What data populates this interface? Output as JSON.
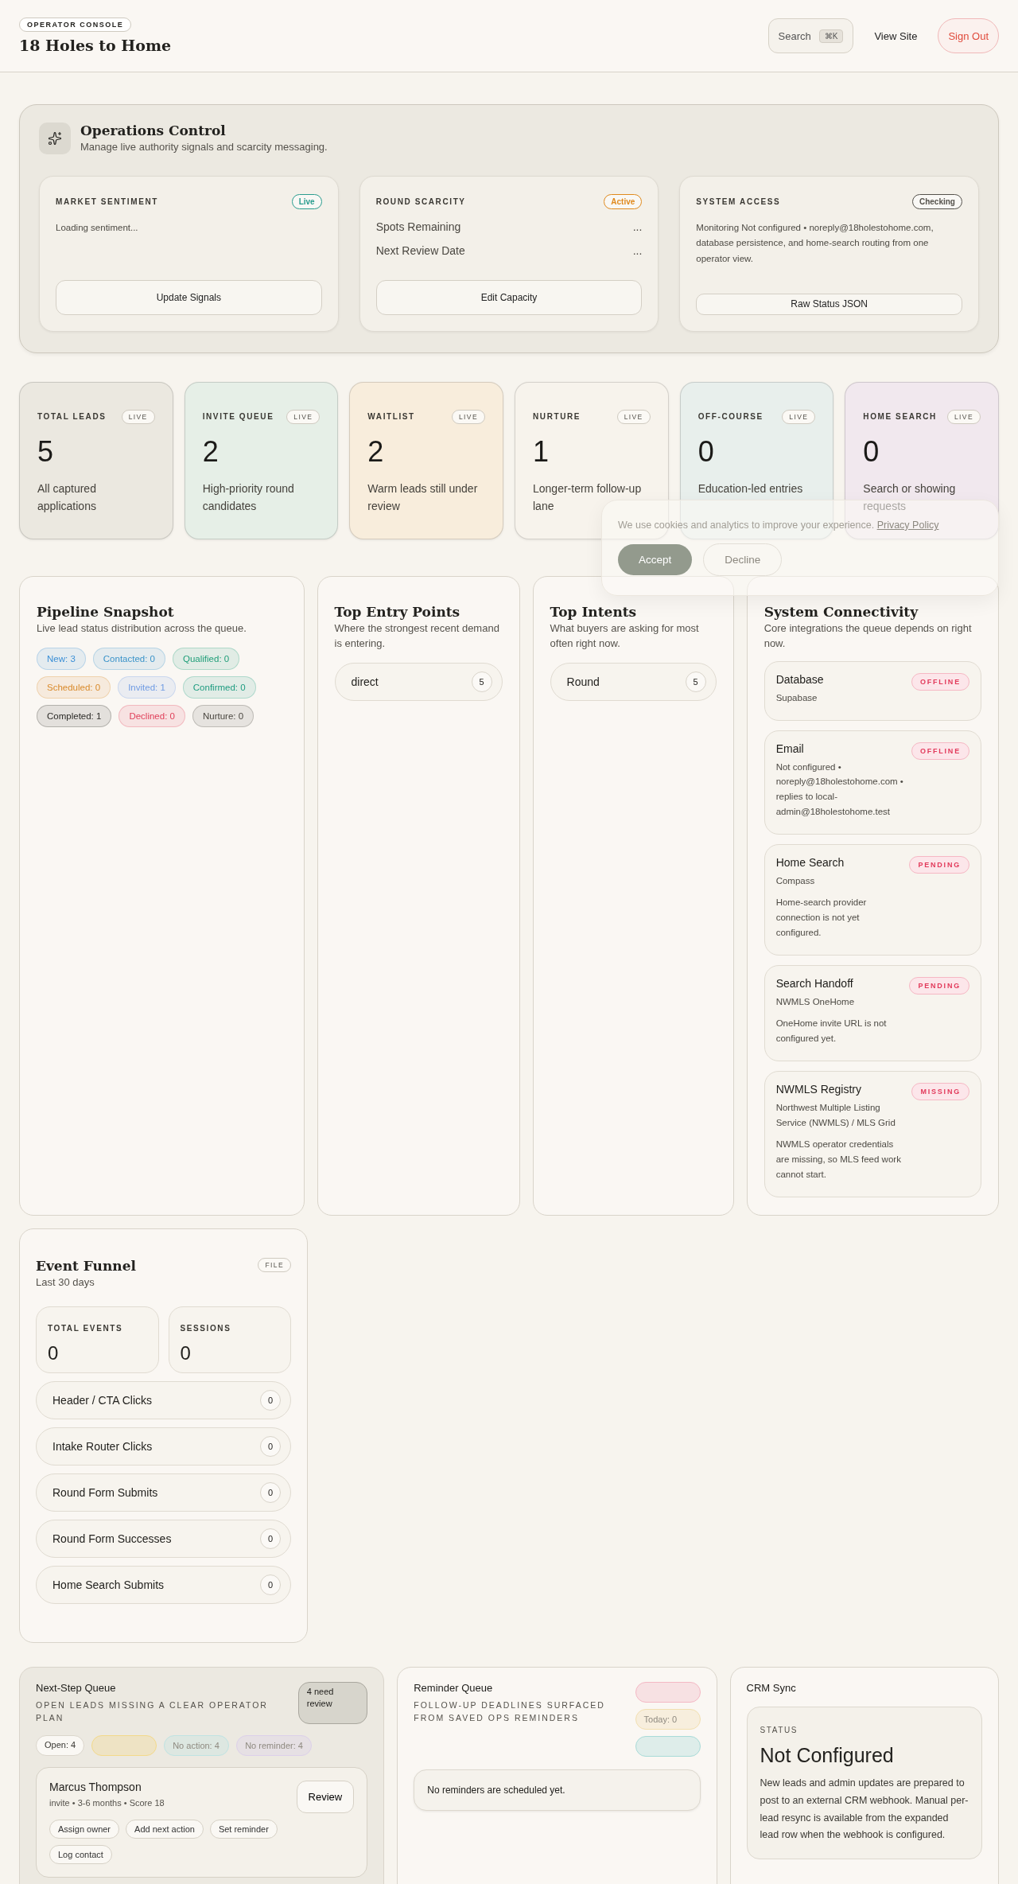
{
  "header": {
    "badge": "OPERATOR CONSOLE",
    "title": "18 Holes to Home",
    "search": {
      "label": "Search",
      "shortcut": "⌘K"
    },
    "view_site": "View Site",
    "sign_out": "Sign Out"
  },
  "operations": {
    "title": "Operations Control",
    "subtitle": "Manage live authority signals and scarcity messaging.",
    "cards": [
      {
        "kind": "sentiment",
        "label": "MARKET SENTIMENT",
        "badge": {
          "text": "Live",
          "color": "#2a9d8f"
        },
        "text": "Loading sentiment...",
        "button": "Update Signals"
      },
      {
        "kind": "scarcity",
        "label": "ROUND SCARCITY",
        "badge": {
          "text": "Active",
          "color": "#e08a1e"
        },
        "rows": [
          {
            "label": "Spots Remaining",
            "value": "..."
          },
          {
            "label": "Next Review Date",
            "value": "..."
          }
        ],
        "button": "Edit Capacity"
      },
      {
        "kind": "access",
        "label": "SYSTEM ACCESS",
        "badge": {
          "text": "Checking",
          "color": "#55524c"
        },
        "text": "Monitoring Not configured • noreply@18holestohome.com, database persistence, and home-search routing from one operator view.",
        "button": "Raw Status JSON"
      }
    ]
  },
  "stats": [
    {
      "label": "TOTAL LEADS",
      "badge": "LIVE",
      "value": "5",
      "description": "All captured applications",
      "color": "#ebe8e0"
    },
    {
      "label": "INVITE QUEUE",
      "badge": "LIVE",
      "value": "2",
      "description": "High-priority round candidates",
      "color": "#e6efe7"
    },
    {
      "label": "WAITLIST",
      "badge": "LIVE",
      "value": "2",
      "description": "Warm leads still under review",
      "color": "#f8eddc"
    },
    {
      "label": "NURTURE",
      "badge": "LIVE",
      "value": "1",
      "description": "Longer-term follow-up lane",
      "color": "#f7f3ec"
    },
    {
      "label": "OFF-COURSE",
      "badge": "LIVE",
      "value": "0",
      "description": "Education-led entries",
      "color": "#e8efec"
    },
    {
      "label": "HOME SEARCH",
      "badge": "LIVE",
      "value": "0",
      "description": "Search or showing requests",
      "color": "#f1e8ee"
    }
  ],
  "cookie": {
    "text": "We use cookies and analytics to improve your experience.",
    "link": "Privacy Policy",
    "accept": "Accept",
    "decline": "Decline"
  },
  "pipeline": {
    "title": "Pipeline Snapshot",
    "subtitle": "Live lead status distribution across the queue.",
    "chips": [
      {
        "label": "New: 3",
        "color": "#3b8fd6"
      },
      {
        "label": "Contacted: 0",
        "color": "#3a93c9"
      },
      {
        "label": "Qualified: 0",
        "color": "#1f9e78"
      },
      {
        "label": "Scheduled: 0",
        "color": "#d98a2b"
      },
      {
        "label": "Invited: 1",
        "color": "#6f9be3"
      },
      {
        "label": "Confirmed: 0",
        "color": "#1e9c80"
      },
      {
        "label": "Completed: 1",
        "color": "#2b2a27"
      },
      {
        "label": "Declined: 0",
        "color": "#e0405a"
      },
      {
        "label": "Nurture: 0",
        "color": "#4a4740"
      }
    ]
  },
  "entry_points": {
    "title": "Top Entry Points",
    "subtitle": "Where the strongest recent demand is entering.",
    "items": [
      {
        "label": "direct",
        "count": "5"
      }
    ]
  },
  "intents": {
    "title": "Top Intents",
    "subtitle": "What buyers are asking for most often right now.",
    "items": [
      {
        "label": "Round",
        "count": "5"
      }
    ]
  },
  "connectivity": {
    "title": "System Connectivity",
    "subtitle": "Core integrations the queue depends on right now.",
    "services": [
      {
        "name": "Database",
        "provider": "Supabase",
        "status": "OFFLINE"
      },
      {
        "name": "Email",
        "provider": "Not configured • noreply@18holestohome.com • replies to local-admin@18holestohome.test",
        "status": "OFFLINE"
      },
      {
        "name": "Home Search",
        "provider": "Compass",
        "note": "Home-search provider connection is not yet configured.",
        "status": "PENDING"
      },
      {
        "name": "Search Handoff",
        "provider": "NWMLS OneHome",
        "note": "OneHome invite URL is not configured yet.",
        "status": "PENDING"
      },
      {
        "name": "NWMLS Registry",
        "provider": "Northwest Multiple Listing Service (NWMLS) / MLS Grid",
        "note": "NWMLS operator credentials are missing, so MLS feed work cannot start.",
        "status": "MISSING"
      }
    ]
  },
  "funnel": {
    "title": "Event Funnel",
    "badge": "FILE",
    "subtitle": "Last 30 days",
    "metrics": [
      {
        "label": "TOTAL EVENTS",
        "value": "0"
      },
      {
        "label": "SESSIONS",
        "value": "0"
      }
    ],
    "rows": [
      {
        "label": "Header / CTA Clicks",
        "count": "0"
      },
      {
        "label": "Intake Router Clicks",
        "count": "0"
      },
      {
        "label": "Round Form Submits",
        "count": "0"
      },
      {
        "label": "Round Form Successes",
        "count": "0"
      },
      {
        "label": "Home Search Submits",
        "count": "0"
      }
    ]
  },
  "next_step": {
    "title": "Next-Step Queue",
    "subtitle": "OPEN LEADS MISSING A CLEAR OPERATOR PLAN",
    "badge": "4 need review",
    "chips": [
      {
        "label": "Open: 4",
        "color": "#3a3833"
      },
      {
        "color": "#f3d98a"
      },
      {
        "label": "No action: 4",
        "color": "#bfe3e2"
      },
      {
        "label": "No reminder: 4",
        "color": "#dcd0ea"
      }
    ],
    "lead": {
      "name": "Marcus Thompson",
      "meta": "invite • 3-6 months • Score 18",
      "button": "Review",
      "actions": [
        "Assign owner",
        "Add next action",
        "Set reminder",
        "Log contact"
      ]
    }
  },
  "reminders": {
    "title": "Reminder Queue",
    "subtitle": "FOLLOW-UP DEADLINES SURFACED FROM SAVED OPS REMINDERS",
    "chips": [
      {
        "color": "#f4b8c4"
      },
      {
        "label": "Today: 0",
        "color": "#f2dfb0"
      },
      {
        "color": "#a9dbd8"
      }
    ],
    "empty": "No reminders are scheduled yet."
  },
  "crm": {
    "title": "CRM Sync",
    "status_label": "STATUS",
    "status": "Not Configured",
    "description": "New leads and admin updates are prepared to post to an external CRM webhook. Manual per-lead resync is available from the expanded lead row when the webhook is configured."
  }
}
